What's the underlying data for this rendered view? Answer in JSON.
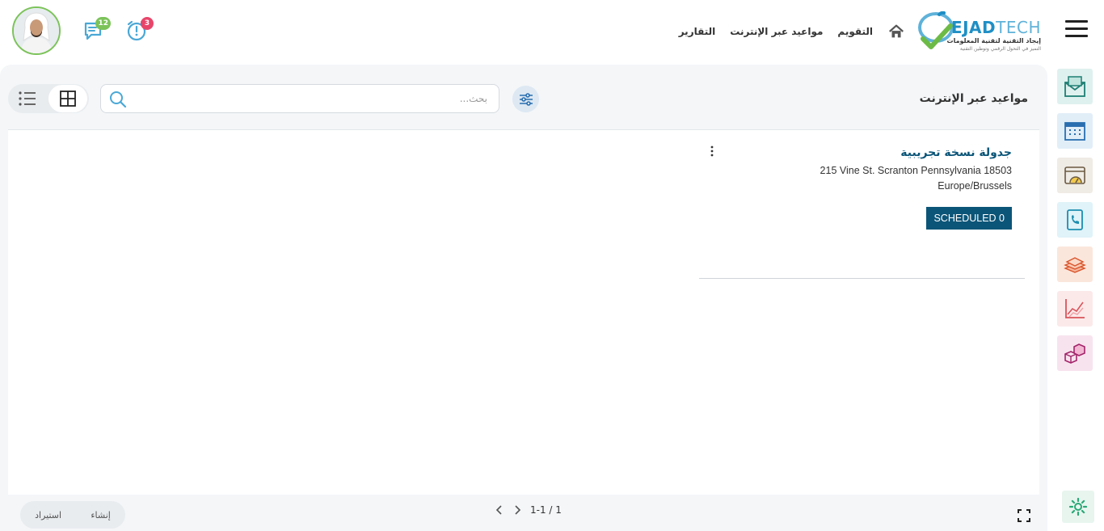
{
  "header": {
    "brand_main": "EJAD",
    "brand_accent": "TECH",
    "brand_tagline": "إيجاد التقنية لتقنية المعلومات",
    "brand_subtagline": "التميز في التحول الرقمي وتوطين التقنية",
    "nav": [
      {
        "label": "التقويم"
      },
      {
        "label": "مواعيد عبر الإنترنت"
      },
      {
        "label": "التقارير"
      }
    ],
    "alarm_badge": "3",
    "chat_badge": "12",
    "icons": {
      "menu": "hamburger-icon",
      "home": "home-icon",
      "alarm": "alarm-clock-icon",
      "chat": "chat-icon"
    }
  },
  "sidebar": {
    "items": [
      {
        "icon": "mail-icon",
        "bg": "#dff1ef"
      },
      {
        "icon": "calendar-icon",
        "bg": "#e1eef8"
      },
      {
        "icon": "dashboard-icon",
        "bg": "#efebe5"
      },
      {
        "icon": "phone-book-icon",
        "bg": "#dff3f8"
      },
      {
        "icon": "cash-icon",
        "bg": "#fbe6dc"
      },
      {
        "icon": "chart-icon",
        "bg": "#fbe9ea"
      },
      {
        "icon": "boxes-icon",
        "bg": "#f7e3ee"
      }
    ],
    "settings_icon": "gear-icon"
  },
  "main": {
    "title": "مواعيد عبر الإنترنت",
    "search_placeholder": "بحث...",
    "card": {
      "title": "جدولة نسخة تجريبية",
      "address": "215 Vine St. Scranton Pennsylvania 18503",
      "timezone": "Europe/Brussels",
      "status": "SCHEDULED 0"
    }
  },
  "footer": {
    "create_label": "إنشاء",
    "import_label": "استيراد",
    "pager_text": "1-1 / 1"
  },
  "colors": {
    "accent": "#0b5578",
    "brand_blue": "#1f8fc5",
    "badge_red": "#e8456a",
    "badge_green": "#7cc35a"
  }
}
